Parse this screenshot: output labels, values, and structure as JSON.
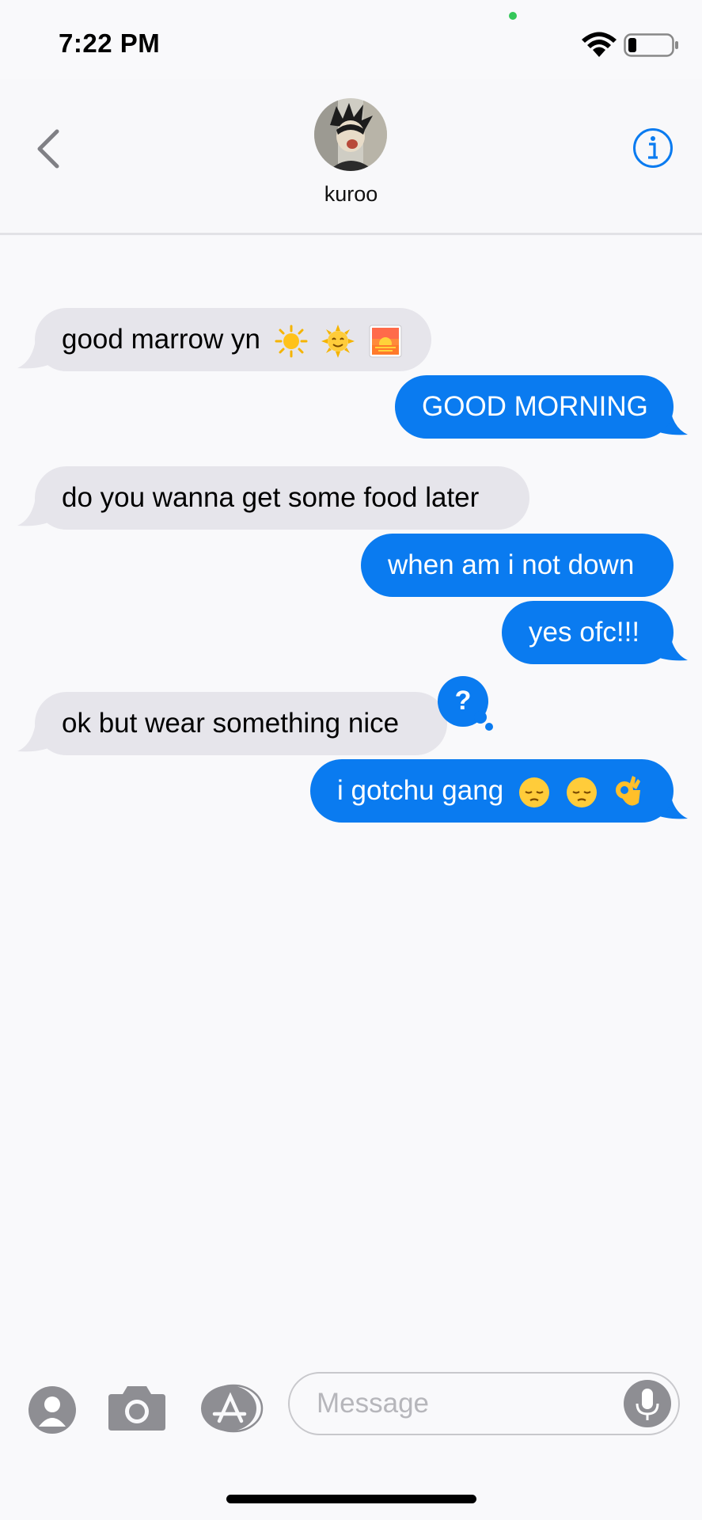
{
  "status_bar": {
    "time": "7:22 PM"
  },
  "header": {
    "contact_name": "kuroo",
    "back_icon": "chevron-left-icon",
    "info_icon": "info-circle-icon"
  },
  "messages": [
    {
      "direction": "in",
      "text": "good marrow yn",
      "emoji": [
        "sun",
        "sun-with-face",
        "sunrise"
      ]
    },
    {
      "direction": "out",
      "text": "GOOD MORNING"
    },
    {
      "direction": "in",
      "text": "do you wanna get some food later"
    },
    {
      "direction": "out",
      "text": "when am i not down"
    },
    {
      "direction": "out",
      "text": "yes ofc!!!"
    },
    {
      "direction": "in",
      "text": "ok but wear something nice",
      "tapback": "?"
    },
    {
      "direction": "out",
      "text": "i gotchu gang",
      "emoji": [
        "pensive-face",
        "pensive-face",
        "ok-hand"
      ]
    }
  ],
  "input_bar": {
    "placeholder": "Message",
    "icons": [
      "contact-app-icon",
      "camera-icon",
      "appstore-icon",
      "mic-icon"
    ]
  },
  "colors": {
    "outgoing_bubble": "#0a7bf0",
    "incoming_bubble": "#e6e5eb",
    "accent": "#0a7bf0"
  }
}
